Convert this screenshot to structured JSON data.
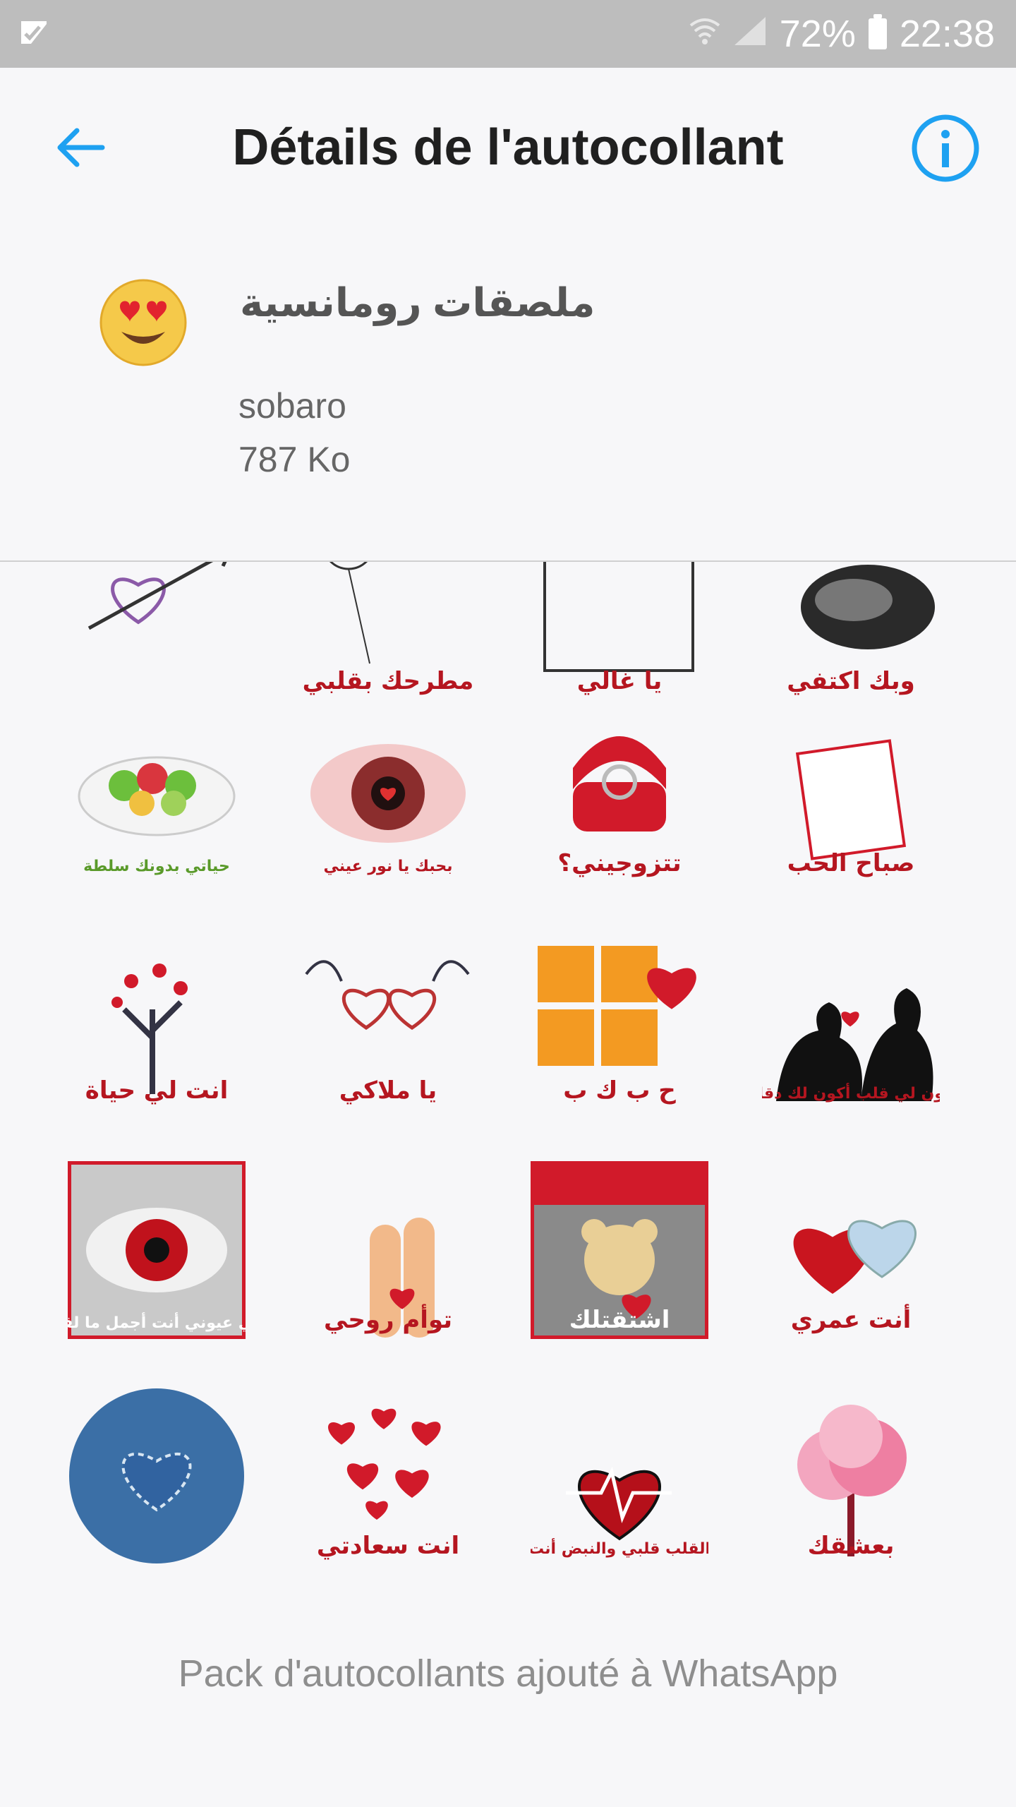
{
  "status_bar": {
    "battery": "72%",
    "time": "22:38"
  },
  "app_bar": {
    "title": "Détails de l'autocollant"
  },
  "pack": {
    "name": "ملصقات رومانسية",
    "publisher": "sobaro",
    "size": "787 Ko"
  },
  "stickers": [
    {
      "name": "sticker-arrow-heart",
      "text": ""
    },
    {
      "name": "sticker-balloon-heart",
      "text": "مطرحك بقلبي"
    },
    {
      "name": "sticker-ya-ghali",
      "text": "يا غالي"
    },
    {
      "name": "sticker-holding-hands",
      "text": "وبك اكتفي"
    },
    {
      "name": "sticker-salad",
      "text": "حياتي بدونك سلطة"
    },
    {
      "name": "sticker-eye",
      "text": "بحبك يا نور عيني"
    },
    {
      "name": "sticker-ring",
      "text": "تتزوجيني؟"
    },
    {
      "name": "sticker-morning-love",
      "text": "صباح الحب"
    },
    {
      "name": "sticker-heart-tree",
      "text": "انت لي حياة"
    },
    {
      "name": "sticker-winged-hearts",
      "text": "يا ملاكي"
    },
    {
      "name": "sticker-letter-blocks",
      "text": "ح ب ك ب"
    },
    {
      "name": "sticker-silhouette-couple",
      "text": "تكون لي قلب أكون لك دقاته"
    },
    {
      "name": "sticker-red-eye",
      "text": "وفي عيوني أنت أجمل ما لقيت"
    },
    {
      "name": "sticker-fingers",
      "text": "توأم روحي"
    },
    {
      "name": "sticker-teddy",
      "text": "اشتقتلك"
    },
    {
      "name": "sticker-puzzle-hearts",
      "text": "أنت عمري"
    },
    {
      "name": "sticker-denim-heart",
      "text": ""
    },
    {
      "name": "sticker-many-hearts",
      "text": "انت سعادتي"
    },
    {
      "name": "sticker-heartbeat",
      "text": "القلب قلبي والنبض أنت"
    },
    {
      "name": "sticker-pink-tree",
      "text": "بعشقك"
    }
  ],
  "footer": {
    "status": "Pack d'autocollants ajouté à WhatsApp"
  },
  "colors": {
    "accent": "#1ea1f1",
    "heart": "#d11a2a",
    "bg": "#f7f7f9"
  }
}
